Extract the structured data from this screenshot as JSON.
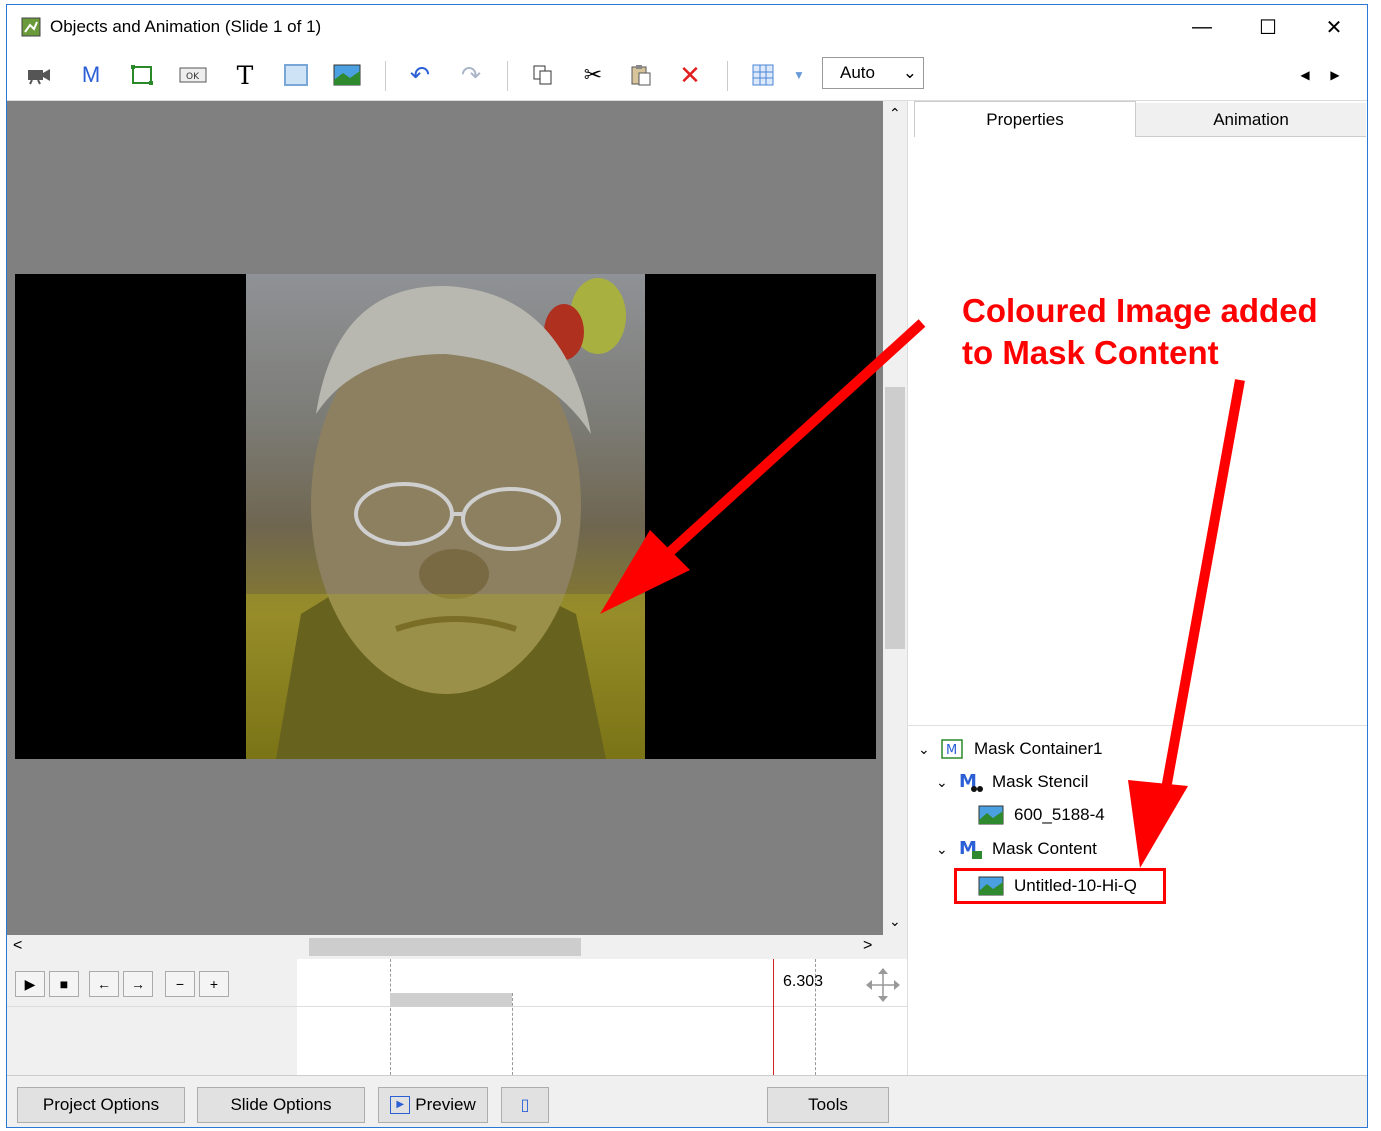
{
  "window": {
    "title": "Objects and Animation (Slide 1 of 1)"
  },
  "toolbar": {
    "icons": [
      "camera-icon",
      "mask-icon",
      "frame-icon",
      "button-icon",
      "text-icon",
      "rectangle-icon",
      "image-icon",
      "undo-icon",
      "redo-icon",
      "copy-icon",
      "cut-icon",
      "paste-icon",
      "delete-icon",
      "grid-icon",
      "grid-dropdown-icon"
    ],
    "zoom_value": "Auto"
  },
  "tabs": {
    "properties": "Properties",
    "animation": "Animation"
  },
  "tree": {
    "container": "Mask Container1",
    "stencil": "Mask Stencil",
    "stencil_image": "600_5188-4",
    "content": "Mask Content",
    "content_image": "Untitled-10-Hi-Q"
  },
  "timeline": {
    "time": "6.303"
  },
  "bottom": {
    "project_options": "Project Options",
    "slide_options": "Slide Options",
    "preview": "Preview",
    "tools": "Tools"
  },
  "annotation": {
    "line1": "Coloured Image added",
    "line2": "to Mask Content",
    "color": "#ff0000"
  }
}
